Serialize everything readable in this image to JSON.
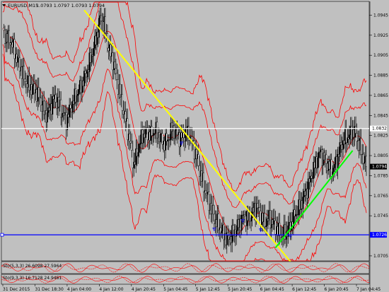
{
  "header": {
    "arrow_icon": "triangle-down-icon",
    "title": "EURUSD,M15",
    "ohlc": "1.0793 1.0797 1.0793 1.0794"
  },
  "price_axis": {
    "min": 1.07,
    "max": 1.0958,
    "labels": [
      "1.0945",
      "1.0925",
      "1.0905",
      "1.0885",
      "1.0865",
      "1.0845",
      "1.0825",
      "1.0805",
      "1.0785",
      "1.0765",
      "1.0745",
      "1.0705"
    ]
  },
  "horizontal_lines": [
    {
      "name": "white-line",
      "price": 1.0832,
      "label": "1.0832",
      "color": "#ffffff",
      "text_color": "#000000"
    },
    {
      "name": "blue-line",
      "price": 1.0726,
      "label": "1.0726",
      "color": "#0000ff",
      "text_color": "#ffffff"
    }
  ],
  "current_price": {
    "value": 1.0794,
    "label": "1.0794"
  },
  "trend_lines": [
    {
      "name": "yellow-trendline",
      "color": "#ffff00",
      "from": {
        "t": 0.225,
        "p": 1.095
      },
      "to": {
        "t": 0.82,
        "p": 1.0684
      }
    },
    {
      "name": "green-trendline",
      "color": "#00ff00",
      "from": {
        "t": 0.745,
        "p": 1.0713
      },
      "to": {
        "t": 0.955,
        "p": 1.081
      }
    }
  ],
  "colors": {
    "background": "#c0c0c0",
    "candles": "#000000",
    "bands": "#ff0000"
  },
  "sub_panels": [
    {
      "name": "stoch-panel-1",
      "label": "Sto(5,3,3) 26.6098 27.5964",
      "color": "#ff0000"
    },
    {
      "name": "stoch-panel-2",
      "label": "Sto(9,3,3) 16.7128 24.9461",
      "color": "#ff0000"
    }
  ],
  "time_axis": {
    "labels": [
      "31 Dec 2015",
      "31 Dec 18:30",
      "4 Jan 04:00",
      "4 Jan 12:00",
      "4 Jan 20:45",
      "5 Jan 04:45",
      "5 Jan 12:45",
      "5 Jan 20:45",
      "6 Jan 04:45",
      "6 Jan 12:45",
      "6 Jan 20:45",
      "7 Jan 04:45"
    ]
  },
  "chart_data": {
    "type": "line",
    "series": [
      {
        "values": [
          1.0928,
          1.0922,
          1.0918,
          1.0905,
          1.0895,
          1.0882,
          1.0875,
          1.0872,
          1.0868,
          1.0858,
          1.0845,
          1.085,
          1.0862,
          1.0858,
          1.0848,
          1.084,
          1.0852,
          1.0862,
          1.087,
          1.088,
          1.089,
          1.0905,
          1.092,
          1.0942,
          1.0935,
          1.0912,
          1.09,
          1.088,
          1.086,
          1.084,
          1.082,
          1.0795,
          1.0812,
          1.0825,
          1.0828,
          1.0825,
          1.083,
          1.0825,
          1.0818,
          1.082,
          1.0832,
          1.0828,
          1.0822,
          1.0826,
          1.0828,
          1.0815,
          1.08,
          1.0782,
          1.0768,
          1.0755,
          1.0742,
          1.0735,
          1.0728,
          1.0722,
          1.0725,
          1.073,
          1.0738,
          1.0745,
          1.0742,
          1.0748,
          1.0755,
          1.0745,
          1.0738,
          1.0742,
          1.0738,
          1.073,
          1.0725,
          1.0728,
          1.0735,
          1.0745,
          1.0752,
          1.0762,
          1.0772,
          1.0785,
          1.0798,
          1.0808,
          1.0802,
          1.0795,
          1.079,
          1.08,
          1.0815,
          1.0822,
          1.0825,
          1.083,
          1.082,
          1.0805,
          1.0794
        ]
      }
    ],
    "ylim": [
      1.07,
      1.0958
    ]
  }
}
